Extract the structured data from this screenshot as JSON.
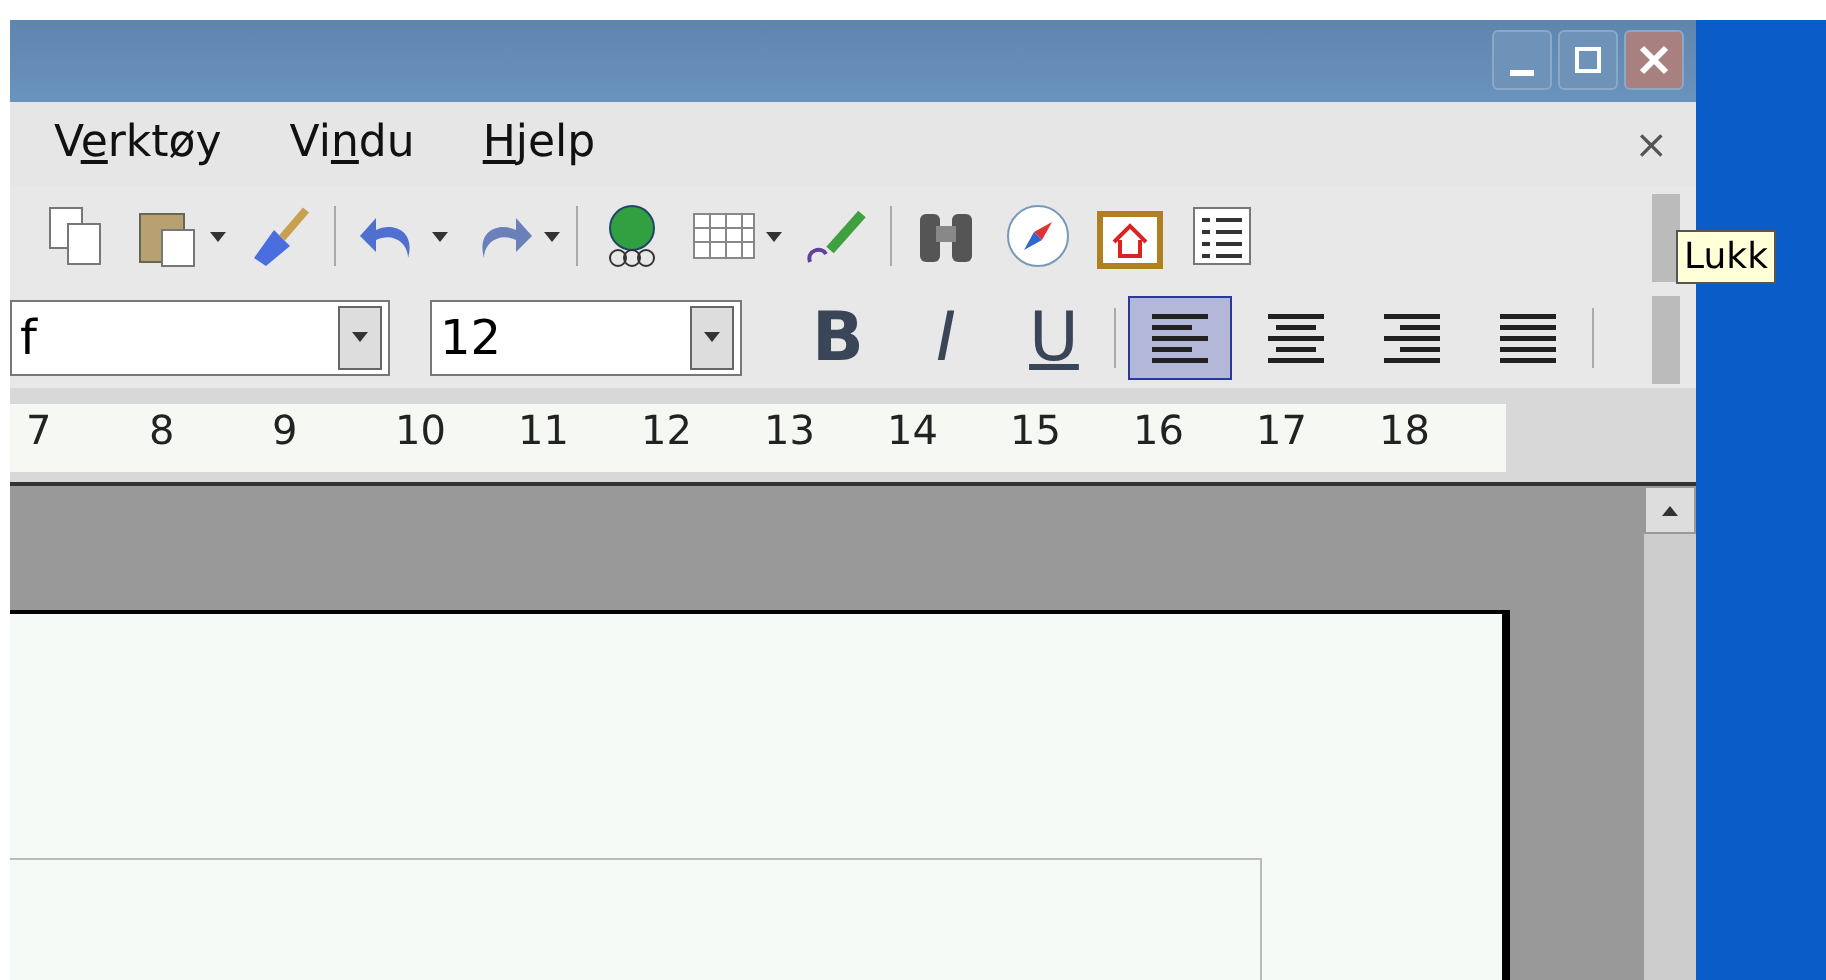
{
  "menu": [
    {
      "before": "V",
      "underlined": "e",
      "after": "rktøy"
    },
    {
      "before": "Vi",
      "underlined": "n",
      "after": "du"
    },
    {
      "underlined": "H",
      "after": "jelp"
    }
  ],
  "menu_close": "×",
  "window_buttons": [
    {
      "kind": "minimize",
      "hovered": false
    },
    {
      "kind": "maximize",
      "hovered": false
    },
    {
      "kind": "close",
      "hovered": true
    }
  ],
  "tooltip": "Lukk",
  "toolbar": [
    {
      "kind": "copy",
      "dropdown": false
    },
    {
      "kind": "paste",
      "dropdown": true
    },
    {
      "kind": "brush",
      "dropdown": false
    },
    {
      "kind": "sep"
    },
    {
      "kind": "undo",
      "dropdown": true
    },
    {
      "kind": "redo",
      "dropdown": true
    },
    {
      "kind": "sep"
    },
    {
      "kind": "globe",
      "dropdown": false
    },
    {
      "kind": "table",
      "dropdown": true
    },
    {
      "kind": "pencil",
      "dropdown": false
    },
    {
      "kind": "sep"
    },
    {
      "kind": "binoculars",
      "dropdown": false
    },
    {
      "kind": "compass",
      "dropdown": false
    },
    {
      "kind": "home",
      "dropdown": false
    },
    {
      "kind": "list",
      "dropdown": false
    }
  ],
  "font_name": {
    "value": "f"
  },
  "font_size": {
    "value": "12"
  },
  "format_buttons": [
    {
      "kind": "bold",
      "label": "B",
      "selected": false
    },
    {
      "kind": "italic",
      "label": "I",
      "selected": false
    },
    {
      "kind": "underline",
      "label": "U",
      "selected": false
    }
  ],
  "align_buttons": [
    {
      "kind": "left",
      "selected": true
    },
    {
      "kind": "center",
      "selected": false
    },
    {
      "kind": "right",
      "selected": false
    },
    {
      "kind": "justify",
      "selected": false
    }
  ],
  "ruler": [
    "7",
    "8",
    "9",
    "10",
    "11",
    "12",
    "13",
    "14",
    "15",
    "16",
    "17",
    "18"
  ]
}
